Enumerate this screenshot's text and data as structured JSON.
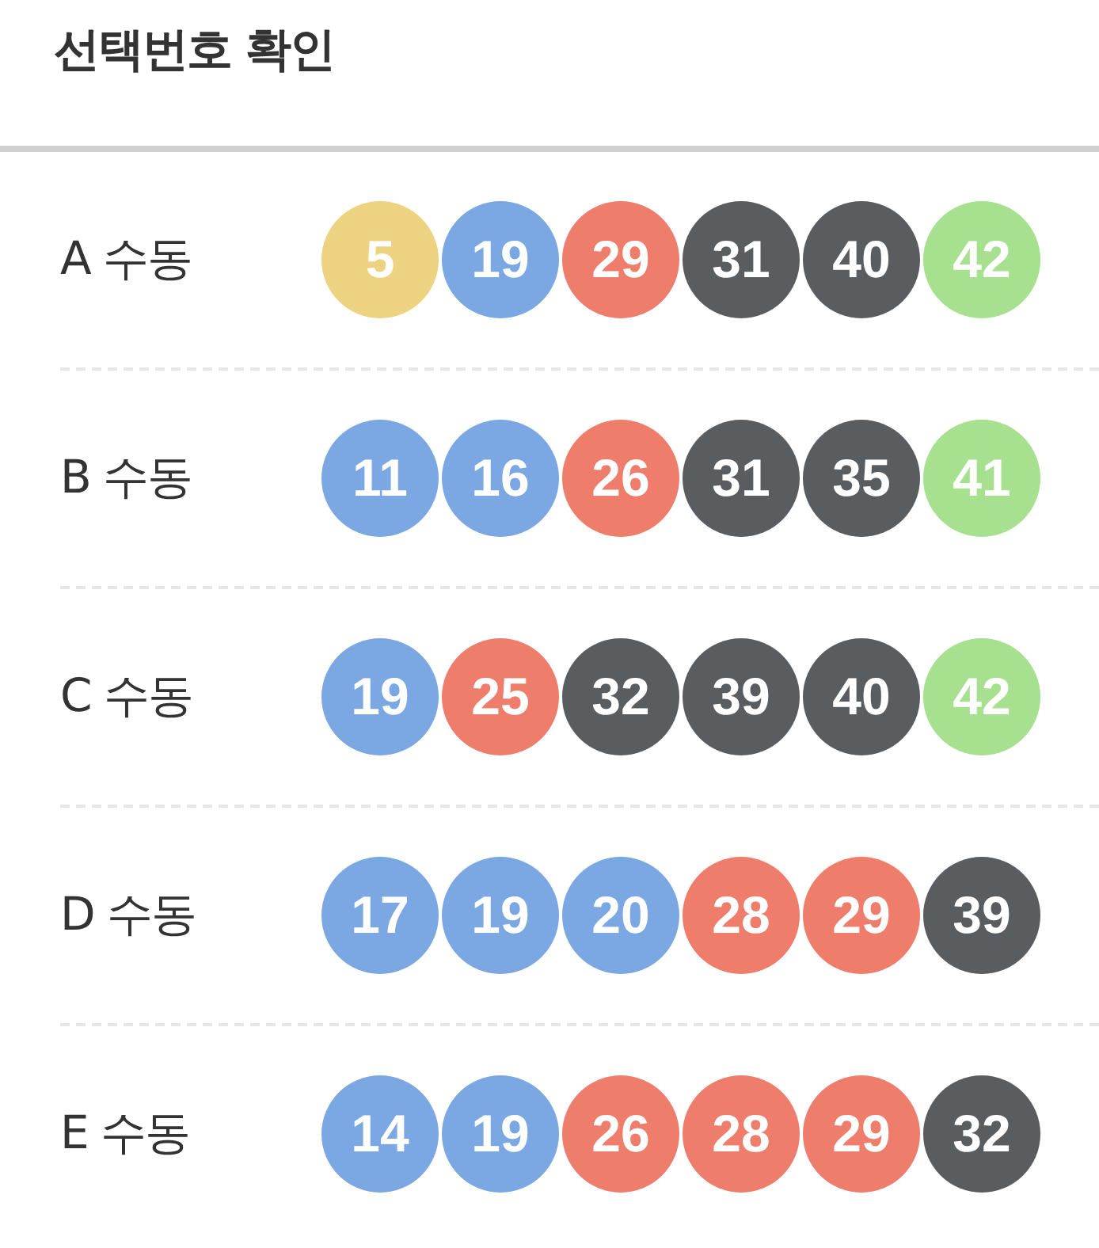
{
  "header": {
    "title": "선택번호 확인"
  },
  "rows": [
    {
      "label": "A 수동",
      "balls": [
        {
          "number": "5",
          "color": "#ecd281"
        },
        {
          "number": "19",
          "color": "#7ba7e3"
        },
        {
          "number": "29",
          "color": "#ee7d6c"
        },
        {
          "number": "31",
          "color": "#5a5d60"
        },
        {
          "number": "40",
          "color": "#5a5d60"
        },
        {
          "number": "42",
          "color": "#a7e08e"
        }
      ]
    },
    {
      "label": "B 수동",
      "balls": [
        {
          "number": "11",
          "color": "#7ba7e3"
        },
        {
          "number": "16",
          "color": "#7ba7e3"
        },
        {
          "number": "26",
          "color": "#ee7d6c"
        },
        {
          "number": "31",
          "color": "#5a5d60"
        },
        {
          "number": "35",
          "color": "#5a5d60"
        },
        {
          "number": "41",
          "color": "#a7e08e"
        }
      ]
    },
    {
      "label": "C 수동",
      "balls": [
        {
          "number": "19",
          "color": "#7ba7e3"
        },
        {
          "number": "25",
          "color": "#ee7d6c"
        },
        {
          "number": "32",
          "color": "#5a5d60"
        },
        {
          "number": "39",
          "color": "#5a5d60"
        },
        {
          "number": "40",
          "color": "#5a5d60"
        },
        {
          "number": "42",
          "color": "#a7e08e"
        }
      ]
    },
    {
      "label": "D 수동",
      "balls": [
        {
          "number": "17",
          "color": "#7ba7e3"
        },
        {
          "number": "19",
          "color": "#7ba7e3"
        },
        {
          "number": "20",
          "color": "#7ba7e3"
        },
        {
          "number": "28",
          "color": "#ee7d6c"
        },
        {
          "number": "29",
          "color": "#ee7d6c"
        },
        {
          "number": "39",
          "color": "#5a5d60"
        }
      ]
    },
    {
      "label": "E 수동",
      "balls": [
        {
          "number": "14",
          "color": "#7ba7e3"
        },
        {
          "number": "19",
          "color": "#7ba7e3"
        },
        {
          "number": "26",
          "color": "#ee7d6c"
        },
        {
          "number": "28",
          "color": "#ee7d6c"
        },
        {
          "number": "29",
          "color": "#ee7d6c"
        },
        {
          "number": "32",
          "color": "#5a5d60"
        }
      ]
    }
  ]
}
